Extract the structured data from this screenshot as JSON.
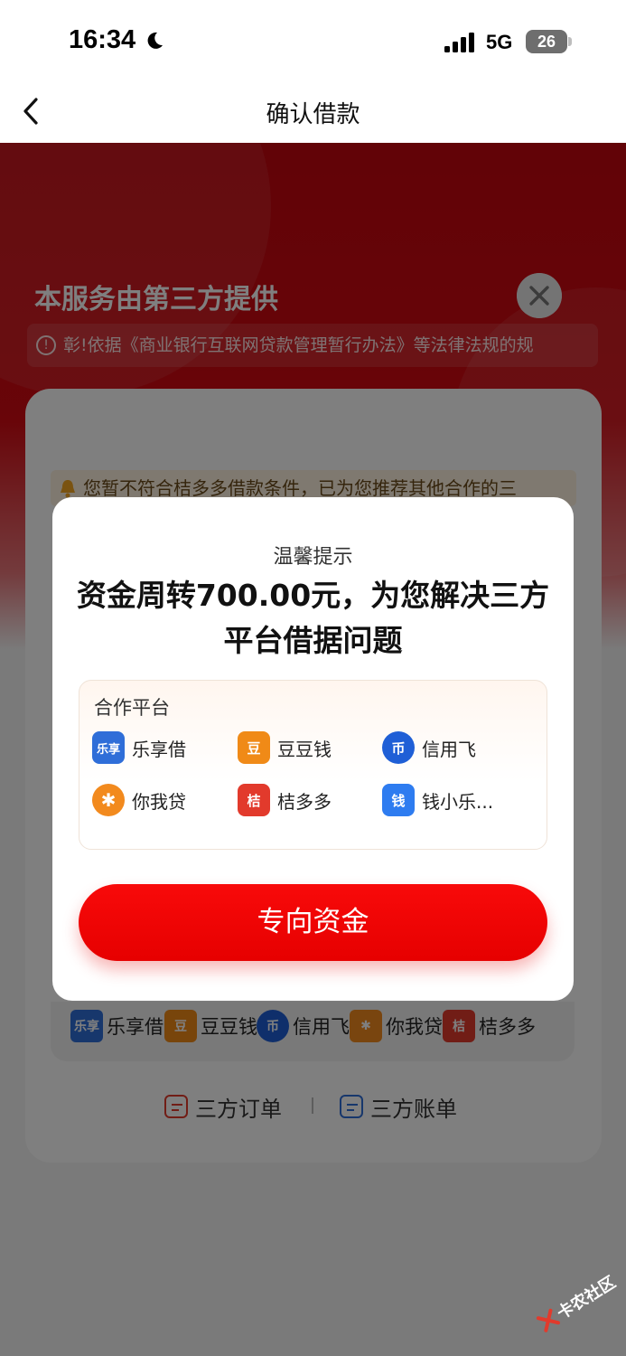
{
  "status_bar": {
    "time": "16:34",
    "network": "5G",
    "battery": "26"
  },
  "nav": {
    "title": "确认借款"
  },
  "hero": {
    "title": "本服务由第三方提供",
    "notice": "彰!依据《商业银行互联网贷款管理暂行办法》等法律法规的规"
  },
  "card": {
    "notice": "您暂不符合桔多多借款条件，已为您推荐其他合作的三",
    "brands": [
      {
        "name": "乐享借",
        "icon": "lexiangjie-logo",
        "color": "#2f6ed8"
      },
      {
        "name": "豆豆钱",
        "icon": "doudouqian-logo",
        "color": "#f08a17"
      },
      {
        "name": "信用飞",
        "icon": "xinyongfei-logo",
        "color": "#1f5fd6"
      },
      {
        "name": "你我贷",
        "icon": "niwodai-logo",
        "color": "#f28a1e"
      },
      {
        "name": "桔多多",
        "icon": "juduoduo-logo",
        "color": "#e23a2c"
      }
    ],
    "links": {
      "orders": "三方订单",
      "bills": "三方账单"
    }
  },
  "modal": {
    "kicker": "温馨提示",
    "heading": "资金周转700.00元，为您解决三方平台借据问题",
    "partners_title": "合作平台",
    "partners": [
      {
        "name": "乐享借",
        "icon": "lexiangjie-logo",
        "color": "#2f6ed8",
        "glyph": "乐享"
      },
      {
        "name": "豆豆钱",
        "icon": "doudouqian-logo",
        "color": "#f08a17",
        "glyph": "豆"
      },
      {
        "name": "信用飞",
        "icon": "xinyongfei-logo",
        "color": "#1f5fd6",
        "glyph": "币"
      },
      {
        "name": "你我贷",
        "icon": "niwodai-logo",
        "color": "#f28a1e",
        "glyph": "✱"
      },
      {
        "name": "桔多多",
        "icon": "juduoduo-logo",
        "color": "#e23a2c",
        "glyph": "桔"
      },
      {
        "name": "钱小乐...",
        "icon": "qianxiaole-logo",
        "color": "#2e7cf0",
        "glyph": "钱"
      }
    ],
    "cta": "专向资金"
  },
  "watermark": "卡农社区",
  "colors": {
    "brand_red": "#e60000",
    "hero_red": "#c4060e"
  }
}
